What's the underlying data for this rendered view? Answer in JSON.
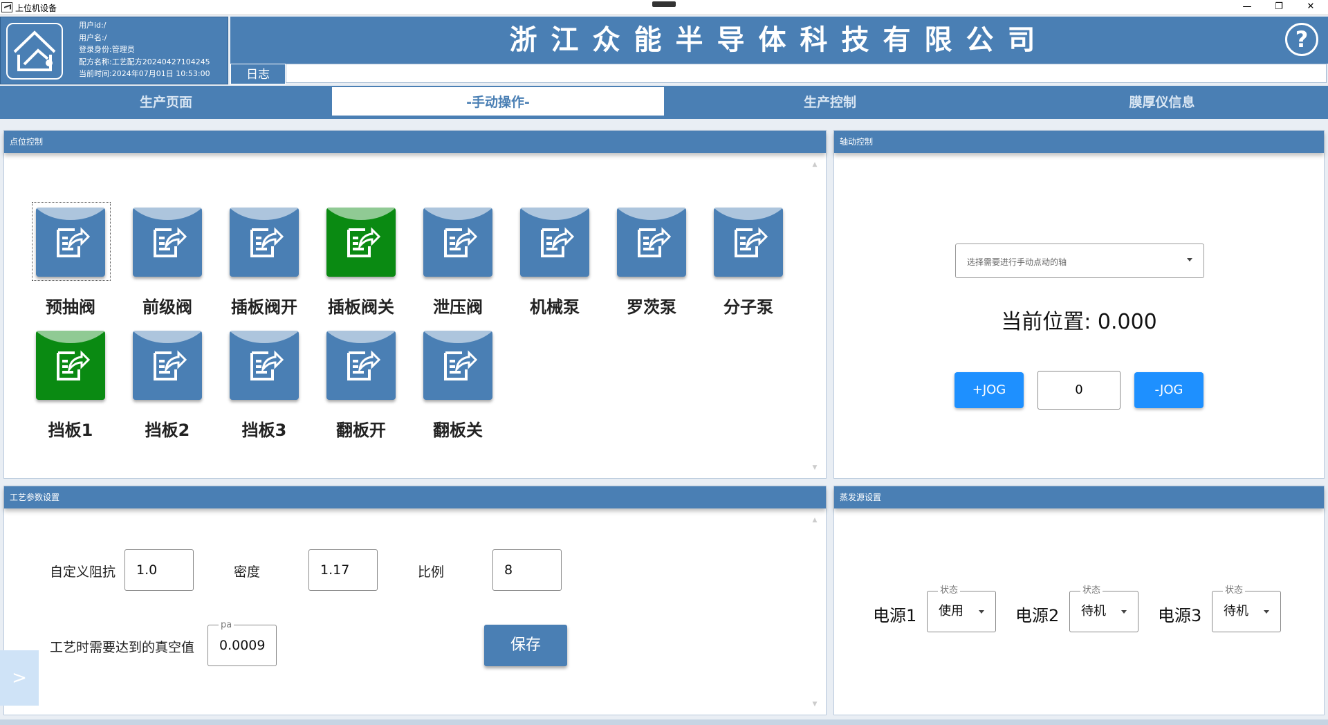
{
  "window": {
    "title": "上位机设备",
    "controls": {
      "minimize": "—",
      "restore": "❐",
      "close": "✕"
    }
  },
  "header": {
    "user_info": [
      "用户id:/",
      "用户名:/",
      "登录身份:管理员",
      "配方名称:工艺配方20240427104245",
      "当前时间:2024年07月01日 10:53:00"
    ],
    "company": "浙江众能半导体科技有限公司",
    "help": "?",
    "log_label": "日志",
    "log_value": ""
  },
  "tabs": [
    {
      "label": "生产页面",
      "active": false
    },
    {
      "label": "-手动操作-",
      "active": true
    },
    {
      "label": "生产控制",
      "active": false
    },
    {
      "label": "膜厚仪信息",
      "active": false
    }
  ],
  "panels": {
    "point_control": "点位控制",
    "axis_control": "轴动控制",
    "process_params": "工艺参数设置",
    "evap_source": "蒸发源设置"
  },
  "valves": [
    {
      "label": "预抽阀",
      "on": false
    },
    {
      "label": "前级阀",
      "on": false
    },
    {
      "label": "插板阀开",
      "on": false
    },
    {
      "label": "插板阀关",
      "on": true
    },
    {
      "label": "泄压阀",
      "on": false
    },
    {
      "label": "机械泵",
      "on": false
    },
    {
      "label": "罗茨泵",
      "on": false
    },
    {
      "label": "分子泵",
      "on": false
    },
    {
      "label": "挡板1",
      "on": true
    },
    {
      "label": "挡板2",
      "on": false
    },
    {
      "label": "挡板3",
      "on": false
    },
    {
      "label": "翻板开",
      "on": false
    },
    {
      "label": "翻板关",
      "on": false
    }
  ],
  "axis": {
    "select_placeholder": "选择需要进行手动点动的轴",
    "current_position_label": "当前位置: 0.000",
    "jog_plus": "+JOG",
    "jog_minus": "-JOG",
    "jog_step": "0"
  },
  "process": {
    "impedance_label": "自定义阻抗",
    "impedance_value": "1.0",
    "density_label": "密度",
    "density_value": "1.17",
    "ratio_label": "比例",
    "ratio_value": "8",
    "vacuum_label": "工艺时需要达到的真空值",
    "vacuum_unit": "pa",
    "vacuum_value": "0.0009",
    "save_label": "保存"
  },
  "power_sources": [
    {
      "label": "电源1",
      "state_caption": "状态",
      "state": "使用"
    },
    {
      "label": "电源2",
      "state_caption": "状态",
      "state": "待机"
    },
    {
      "label": "电源3",
      "state_caption": "状态",
      "state": "待机"
    }
  ],
  "side_toggle": ">",
  "colors": {
    "primary": "#4a7fb4",
    "on": "#0a8a12",
    "jog": "#1e90ff"
  }
}
